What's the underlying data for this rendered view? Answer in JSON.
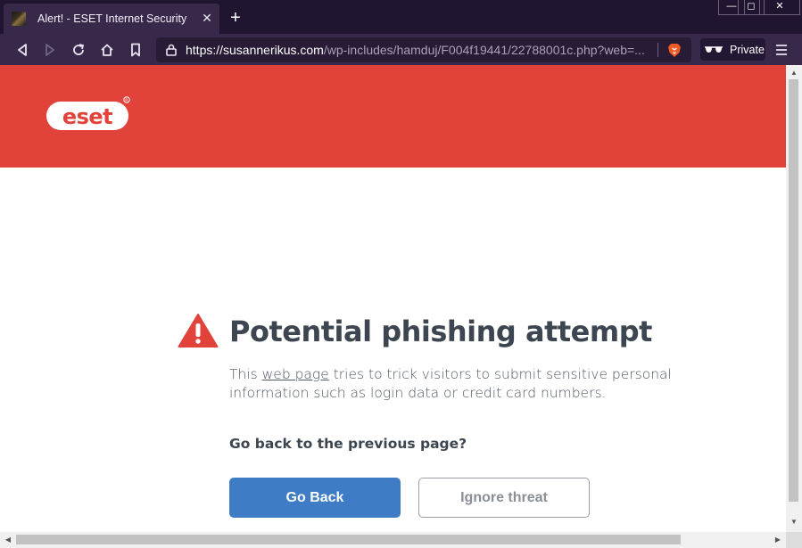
{
  "browser": {
    "tab_title": "Alert! - ESET Internet Security",
    "new_tab_symbol": "+",
    "url_host": "https://susannerikus.com",
    "url_path": "/wp-includes/hamduj/F004f19441/22788001c.php?web=...",
    "private_label": "Private",
    "icons": [
      "back-icon",
      "forward-icon",
      "reload-icon",
      "home-icon",
      "bookmark-icon",
      "lock-icon",
      "brave-lion-icon",
      "private-glasses-icon",
      "menu-icon"
    ]
  },
  "page": {
    "brand": "eset",
    "brand_color": "#e1433b",
    "title": "Potential phishing attempt",
    "desc_before": "This ",
    "desc_link": "web page",
    "desc_after": " tries to trick visitors to submit sensitive personal information such as login data or credit card numbers.",
    "question": "Go back to the previous page?",
    "go_back_label": "Go Back",
    "ignore_label": "Ignore threat",
    "accent_color": "#3e7dc6",
    "warning_color": "#e1433b"
  }
}
